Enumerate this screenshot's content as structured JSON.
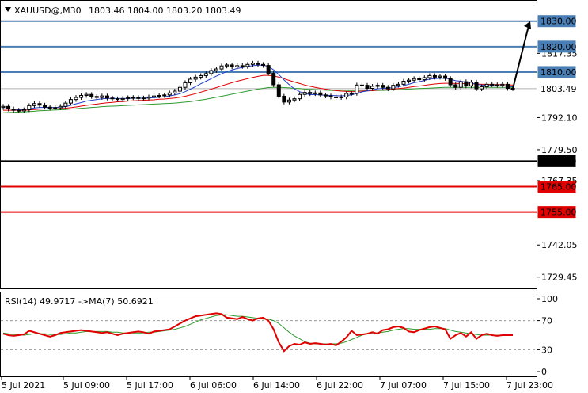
{
  "header": {
    "symbol_label": "XAUUSD@,M30",
    "ohlc": "1803.46 1804.00 1803.20 1803.49"
  },
  "chart_data": [
    {
      "type": "candlestick",
      "title": "XAUUSD@,M30",
      "ylim": [
        1725.0,
        1838.0
      ],
      "y_ticks": [
        "1817.35",
        "1792.10",
        "1779.50",
        "1767.35",
        "1742.05",
        "1729.45"
      ],
      "x_ticks": [
        "5 Jul 2021",
        "5 Jul 09:00",
        "5 Jul 17:00",
        "6 Jul 06:00",
        "6 Jul 14:00",
        "6 Jul 22:00",
        "7 Jul 07:00",
        "7 Jul 15:00",
        "7 Jul 23:00"
      ],
      "horizontal_levels": [
        {
          "value": 1830.0,
          "label": "1830.00",
          "color": "#4a7fb5"
        },
        {
          "value": 1820.0,
          "label": "1820.00",
          "color": "#4a7fb5"
        },
        {
          "value": 1810.0,
          "label": "1810.00",
          "color": "#4a7fb5"
        },
        {
          "value": 1775.0,
          "label": "1775.00",
          "color": "#000000"
        },
        {
          "value": 1765.0,
          "label": "1765.00",
          "color": "#e00000"
        },
        {
          "value": 1755.0,
          "label": "1755.00",
          "color": "#e00000"
        }
      ],
      "current_price": {
        "value": 1803.49,
        "label": "1803.49"
      },
      "arrow": {
        "from": 1803.5,
        "to": 1830.0
      },
      "close_values": [
        1796.5,
        1795.5,
        1795.0,
        1794.8,
        1795.2,
        1796.8,
        1797.6,
        1797.0,
        1796.2,
        1795.8,
        1796.0,
        1796.5,
        1797.8,
        1799.2,
        1800.0,
        1800.8,
        1801.2,
        1800.4,
        1800.0,
        1800.6,
        1799.8,
        1799.5,
        1799.2,
        1799.6,
        1799.9,
        1800.0,
        1799.6,
        1799.8,
        1800.2,
        1800.6,
        1800.8,
        1801.0,
        1801.8,
        1802.5,
        1804.0,
        1805.8,
        1807.2,
        1808.0,
        1808.6,
        1809.4,
        1810.6,
        1811.2,
        1812.4,
        1812.8,
        1812.0,
        1812.5,
        1812.2,
        1813.0,
        1813.5,
        1813.0,
        1812.6,
        1809.5,
        1805.0,
        1800.5,
        1798.2,
        1799.0,
        1799.5,
        1801.2,
        1802.0,
        1801.5,
        1801.8,
        1801.0,
        1800.6,
        1800.2,
        1800.0,
        1800.2,
        1801.6,
        1801.6,
        1804.9,
        1804.8,
        1803.6,
        1804.4,
        1804.8,
        1804.0,
        1803.4,
        1804.8,
        1805.2,
        1806.4,
        1806.8,
        1807.4,
        1807.0,
        1807.8,
        1808.6,
        1808.0,
        1808.4,
        1807.5,
        1805.0,
        1804.0,
        1806.2,
        1804.6,
        1806.0,
        1803.4,
        1804.2,
        1805.2,
        1805.0,
        1804.8,
        1805.2,
        1803.6,
        1803.49
      ],
      "ma_fast": [
        1795.6,
        1795.5,
        1795.4,
        1795.3,
        1795.3,
        1795.6,
        1795.9,
        1796.1,
        1796.1,
        1796.1,
        1796.1,
        1796.2,
        1796.4,
        1796.9,
        1797.5,
        1798.0,
        1798.6,
        1798.9,
        1799.2,
        1799.5,
        1799.6,
        1799.6,
        1799.6,
        1799.6,
        1799.6,
        1799.7,
        1799.7,
        1799.7,
        1799.8,
        1799.9,
        1800.1,
        1800.3,
        1800.6,
        1801.0,
        1801.5,
        1802.3,
        1803.3,
        1804.3,
        1805.4,
        1806.4,
        1807.4,
        1808.4,
        1809.3,
        1810.2,
        1810.8,
        1811.4,
        1811.8,
        1812.2,
        1812.5,
        1812.7,
        1812.7,
        1812.2,
        1810.9,
        1809.0,
        1806.9,
        1805.1,
        1803.4,
        1802.3,
        1801.6,
        1801.1,
        1801.1,
        1801.0,
        1800.9,
        1800.8,
        1800.7,
        1800.6,
        1800.8,
        1801.0,
        1801.6,
        1802.2,
        1802.6,
        1803.0,
        1803.4,
        1803.6,
        1803.7,
        1803.9,
        1804.2,
        1804.7,
        1805.2,
        1805.8,
        1806.2,
        1806.7,
        1807.2,
        1807.4,
        1807.6,
        1807.6,
        1807.2,
        1806.6,
        1806.4,
        1806.0,
        1805.7,
        1805.2,
        1804.9,
        1804.8,
        1804.7,
        1804.6,
        1804.6,
        1804.4,
        1804.2
      ],
      "ma_mid": [
        1795.0,
        1795.0,
        1795.0,
        1795.0,
        1795.0,
        1795.1,
        1795.3,
        1795.4,
        1795.5,
        1795.5,
        1795.6,
        1795.6,
        1795.8,
        1796.0,
        1796.3,
        1796.6,
        1796.9,
        1797.2,
        1797.4,
        1797.7,
        1797.9,
        1798.1,
        1798.3,
        1798.4,
        1798.6,
        1798.7,
        1798.8,
        1798.9,
        1799.0,
        1799.1,
        1799.3,
        1799.4,
        1799.6,
        1799.8,
        1800.1,
        1800.5,
        1801.0,
        1801.5,
        1802.1,
        1802.7,
        1803.3,
        1803.9,
        1804.6,
        1805.2,
        1805.8,
        1806.4,
        1806.9,
        1807.4,
        1807.9,
        1808.3,
        1808.7,
        1808.7,
        1808.5,
        1808.0,
        1807.4,
        1806.7,
        1806.1,
        1805.5,
        1804.9,
        1804.4,
        1804.0,
        1803.6,
        1803.3,
        1803.0,
        1802.7,
        1802.5,
        1802.4,
        1802.3,
        1802.4,
        1802.5,
        1802.6,
        1802.7,
        1802.9,
        1803.0,
        1803.1,
        1803.3,
        1803.5,
        1803.7,
        1804.0,
        1804.3,
        1804.5,
        1804.8,
        1805.1,
        1805.3,
        1805.5,
        1805.6,
        1805.6,
        1805.5,
        1805.5,
        1805.4,
        1805.4,
        1805.3,
        1805.2,
        1805.2,
        1805.1,
        1805.1,
        1805.1,
        1805.0,
        1804.9
      ],
      "ma_slow": [
        1794.0,
        1794.1,
        1794.2,
        1794.3,
        1794.4,
        1794.5,
        1794.6,
        1794.8,
        1794.9,
        1795.0,
        1795.1,
        1795.2,
        1795.3,
        1795.5,
        1795.6,
        1795.8,
        1795.9,
        1796.1,
        1796.2,
        1796.4,
        1796.5,
        1796.6,
        1796.7,
        1796.8,
        1796.9,
        1797.0,
        1797.1,
        1797.2,
        1797.3,
        1797.4,
        1797.5,
        1797.6,
        1797.7,
        1797.8,
        1798.0,
        1798.2,
        1798.4,
        1798.7,
        1799.0,
        1799.3,
        1799.7,
        1800.1,
        1800.5,
        1800.9,
        1801.3,
        1801.7,
        1802.1,
        1802.5,
        1802.9,
        1803.3,
        1803.6,
        1803.9,
        1804.0,
        1804.0,
        1803.9,
        1803.8,
        1803.6,
        1803.5,
        1803.3,
        1803.2,
        1803.1,
        1803.0,
        1802.9,
        1802.8,
        1802.7,
        1802.6,
        1802.6,
        1802.6,
        1802.6,
        1802.6,
        1802.7,
        1802.7,
        1802.8,
        1802.8,
        1802.9,
        1803.0,
        1803.1,
        1803.2,
        1803.3,
        1803.4,
        1803.5,
        1803.6,
        1803.7,
        1803.8,
        1803.9,
        1804.0,
        1804.0,
        1804.0,
        1804.0,
        1804.0,
        1804.0,
        1804.0,
        1804.0,
        1804.0,
        1804.0,
        1804.0,
        1804.0,
        1804.0,
        1804.0
      ]
    },
    {
      "type": "line",
      "title": "RSI(14) 49.9717  ->MA(7) 50.6921",
      "ylim": [
        0,
        100
      ],
      "y_ticks": [
        "100",
        "70",
        "30",
        "0"
      ],
      "dotted_levels": [
        70,
        30
      ],
      "series": [
        {
          "name": "RSI(14)",
          "color": "#e00000",
          "values": [
            52,
            50,
            49,
            50,
            51,
            56,
            54,
            52,
            50,
            48,
            50,
            53,
            54,
            55,
            56,
            57,
            56,
            55,
            54,
            53,
            54,
            52,
            50,
            52,
            53,
            54,
            55,
            54,
            52,
            55,
            56,
            57,
            58,
            62,
            66,
            70,
            73,
            76,
            77,
            78,
            79,
            80,
            79,
            74,
            73,
            72,
            75,
            72,
            70,
            73,
            74,
            70,
            58,
            40,
            28,
            35,
            38,
            37,
            40,
            38,
            39,
            38,
            37,
            38,
            36,
            41,
            47,
            56,
            50,
            51,
            52,
            54,
            52,
            57,
            58,
            61,
            62,
            60,
            55,
            54,
            57,
            59,
            61,
            62,
            60,
            58,
            45,
            50,
            53,
            48,
            54,
            45,
            50,
            52,
            50,
            49,
            50,
            50,
            49.97
          ]
        },
        {
          "name": "MA(7)",
          "color": "#2e9b2e",
          "values": [
            53,
            52,
            51,
            51,
            50,
            51,
            52,
            52,
            52,
            51,
            51,
            51,
            52,
            53,
            53,
            54,
            55,
            55,
            55,
            55,
            55,
            54,
            54,
            53,
            53,
            53,
            53,
            53,
            54,
            54,
            55,
            56,
            57,
            58,
            60,
            62,
            65,
            68,
            71,
            73,
            75,
            77,
            78,
            78,
            77,
            76,
            76,
            75,
            74,
            73,
            72,
            72,
            70,
            66,
            60,
            54,
            49,
            45,
            41,
            39,
            38,
            38,
            38,
            38,
            38,
            39,
            41,
            44,
            47,
            50,
            52,
            53,
            53,
            54,
            55,
            57,
            58,
            59,
            59,
            58,
            58,
            58,
            58,
            59,
            59,
            59,
            57,
            55,
            54,
            53,
            52,
            51,
            50,
            50,
            50,
            50,
            50,
            50,
            50.69
          ]
        }
      ]
    }
  ]
}
